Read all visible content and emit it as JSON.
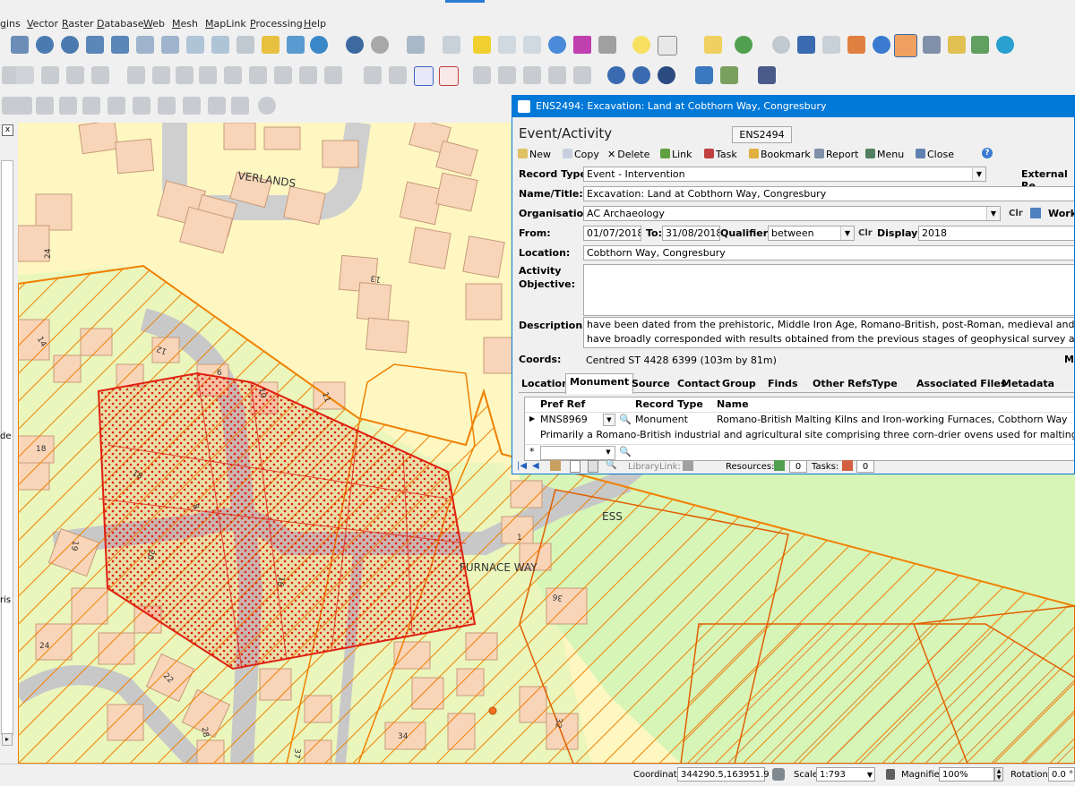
{
  "menu": [
    "gins",
    "Vector",
    "Raster",
    "Database",
    "Web",
    "Mesh",
    "MapLink",
    "Processing",
    "Help"
  ],
  "map_labels": {
    "verlands": "VERLANDS",
    "furnace_way": "FURNACE WAY",
    "ess": "ESS",
    "n24a": "24",
    "n13": "13",
    "n14": "14",
    "n12": "12",
    "n6": "6",
    "n10": "10",
    "n11": "11",
    "n18a": "18",
    "n18b": "18",
    "n8": "8",
    "n1": "1",
    "n19": "19",
    "n20": "20",
    "n16": "16",
    "n36": "36",
    "n24b": "24",
    "n22": "22",
    "n28": "28",
    "n34": "34",
    "n32": "32",
    "n37": "37",
    "left_de": "de",
    "left_ris": "ris"
  },
  "status": {
    "coordinate_label": "Coordinate",
    "coordinate_value": "344290.5,163951.9",
    "scale_label": "Scale",
    "scale_value": "1:793",
    "magnifier_label": "Magnifier",
    "magnifier_value": "100%",
    "rotation_label": "Rotation",
    "rotation_value": "0.0 °"
  },
  "dialog": {
    "title": "ENS2494: Excavation: Land at Cobthorn Way, Congresbury",
    "heading": "Event/Activity",
    "record_id": "ENS2494",
    "actions": [
      "New",
      "Copy",
      "Delete",
      "Link",
      "Task",
      "Bookmark",
      "Report",
      "Menu",
      "Close"
    ],
    "record_type_label": "Record Type:",
    "record_type_value": "Event - Intervention",
    "external_ref_label": "External Re",
    "name_label": "Name/Title:",
    "name_value": "Excavation: Land at Cobthorn Way, Congresbury",
    "org_label": "Organisation:",
    "org_value": "AC Archaeology",
    "clr_label": "Clr",
    "work_label": "Work",
    "from_label": "From:",
    "from_value": "01/07/2018",
    "to_label": "To:",
    "to_value": "31/08/2018",
    "qualifier_label": "Qualifier:",
    "qualifier_value": "between",
    "display_label": "Display:",
    "display_value": "2018",
    "location_label": "Location:",
    "location_value": "Cobthorn Way, Congresbury",
    "objective_label_1": "Activity",
    "objective_label_2": "Objective:",
    "description_label": "Description:",
    "description_line1": "have been dated from the prehistoric, Middle Iron Age, Romano-British, post-Roman, medieval and post-",
    "description_line2": "have broadly corresponded with results obtained from the previous stages of geophysical survey and trial",
    "coords_label": "Coords:",
    "coords_value": "Centred ST 4428 6399 (103m by 81m)",
    "coords_right": "Ma",
    "tabs": [
      "Location",
      "Monument",
      "Source",
      "Contact",
      "Group",
      "Finds",
      "Other Refs",
      "Type",
      "Associated Files",
      "Metadata"
    ],
    "grid_headers": [
      "Pref Ref",
      "Record Type",
      "Name"
    ],
    "row_ref": "MNS8969",
    "row_type": "Monument",
    "row_name": "Romano-British Malting Kilns and Iron-working Furnaces, Cobthorn Way",
    "row_desc": "Primarily a Romano-British industrial and agricultural site comprising three corn-drier ovens used for malting spelt g",
    "new_row_marker": "*",
    "library_link_label": "LibraryLink:",
    "resources_label": "Resources:",
    "resources_value": "0",
    "tasks_label": "Tasks:",
    "tasks_value": "0"
  },
  "colors": {
    "accent": "#0078d7",
    "map_residential": "#fef7c2",
    "map_building": "#f8d5b8",
    "map_green": "#d8f5b8",
    "map_road": "#c8c8c8",
    "hatch": "#f08000",
    "excavation": "#e03010"
  }
}
